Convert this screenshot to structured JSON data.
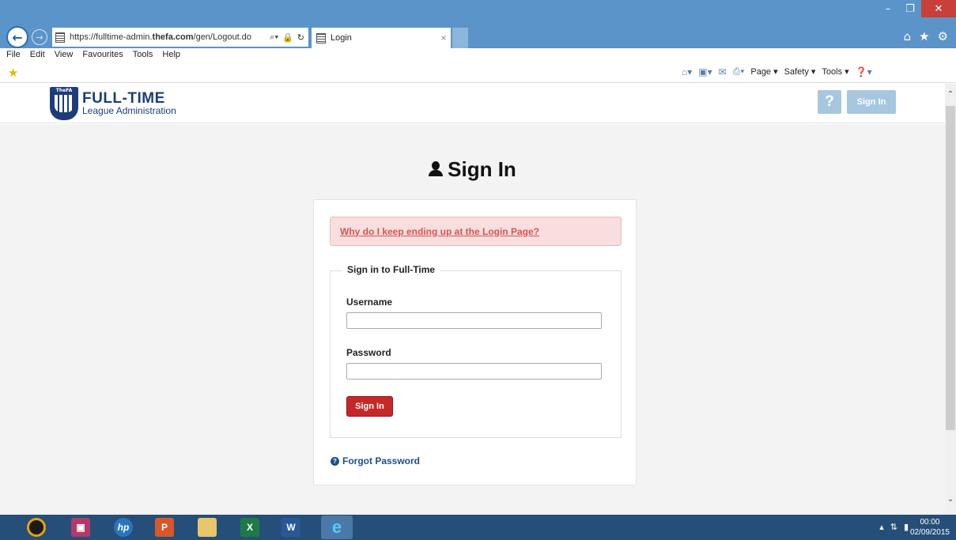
{
  "browser": {
    "url_prefix": "https://fulltime-admin.",
    "url_domain": "thefa.com",
    "url_path": "/gen/Logout.do",
    "tab_title": "Login",
    "menu": [
      "File",
      "Edit",
      "View",
      "Favourites",
      "Tools",
      "Help"
    ],
    "command_bar": {
      "page": "Page ▾",
      "safety": "Safety ▾",
      "tools": "Tools ▾"
    }
  },
  "header": {
    "brand_title": "FULL-TIME",
    "brand_subtitle": "League Administration",
    "crest_text": "TheFA",
    "help_label": "?",
    "signin_label": "Sign In"
  },
  "page": {
    "heading": "Sign In",
    "alert_link": "Why do I keep ending up at the Login Page?",
    "form_legend": "Sign in to Full-Time",
    "username_label": "Username",
    "username_value": "",
    "password_label": "Password",
    "password_value": "",
    "submit_label": "Sign In",
    "forgot_label": "Forgot Password"
  },
  "taskbar": {
    "time": "00:00",
    "date": "02/09/2015"
  },
  "colors": {
    "titlebar": "#5b94c8",
    "brand_navy": "#1d3d7a",
    "alert_bg": "#f8dede",
    "alert_text": "#d9534f",
    "submit_bg": "#c62828",
    "header_btn": "#a7c7e0",
    "taskbar": "#254f78"
  }
}
